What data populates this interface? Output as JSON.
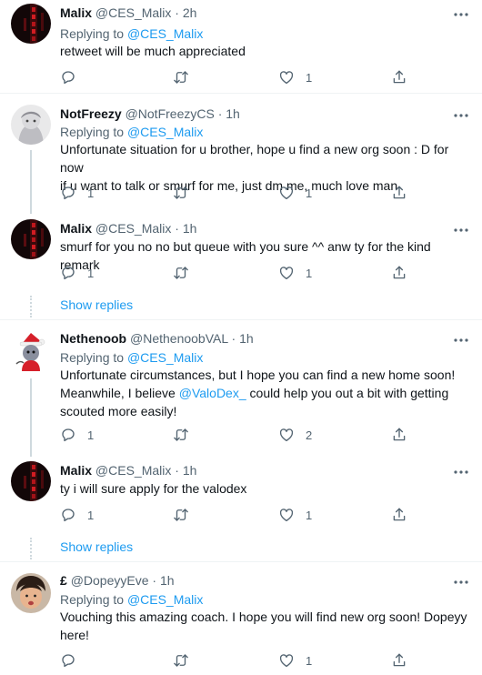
{
  "tweets": [
    {
      "name": "Malix",
      "handle": "@CES_Malix",
      "time": "2h",
      "replying_label": "Replying to",
      "replying_to": "@CES_Malix",
      "text": "retweet will be much appreciated",
      "replies": "",
      "retweets": "",
      "likes": "1"
    },
    {
      "name": "NotFreezy",
      "handle": "@NotFreezyCS",
      "time": "1h",
      "replying_label": "Replying to",
      "replying_to": "@CES_Malix",
      "text_line1": "Unfortunate situation for u brother, hope u find a new org soon : D for now",
      "text_line2": "if u want to talk or smurf for me, just dm me, much love man",
      "replies": "1",
      "retweets": "",
      "likes": "1"
    },
    {
      "name": "Malix",
      "handle": "@CES_Malix",
      "time": "1h",
      "text": "smurf for you no no but queue with you sure ^^ anw ty for the kind remark",
      "replies": "1",
      "retweets": "",
      "likes": "1"
    },
    {
      "name": "Nethenoob",
      "handle": "@NethenoobVAL",
      "time": "1h",
      "replying_label": "Replying to",
      "replying_to": "@CES_Malix",
      "text_line1": "Unfortunate circumstances, but I hope you can find a new home soon!",
      "text_line2_pre": "Meanwhile, I believe ",
      "text_line2_mention": "@ValoDex_",
      "text_line2_post": " could help you out a bit with getting",
      "text_line3": "scouted more easily!",
      "replies": "1",
      "retweets": "",
      "likes": "2"
    },
    {
      "name": "Malix",
      "handle": "@CES_Malix",
      "time": "1h",
      "text": "ty i will sure apply for the valodex",
      "replies": "1",
      "retweets": "",
      "likes": "1"
    },
    {
      "name": "£",
      "handle": "@DopeyyEve",
      "time": "1h",
      "replying_label": "Replying to",
      "replying_to": "@CES_Malix",
      "text_line1": "Vouching this amazing coach. I hope you will find new org soon! Dopeyy",
      "text_line2": "here!",
      "replies": "",
      "retweets": "",
      "likes": "1"
    }
  ],
  "show_replies_label": "Show replies",
  "separator_dot": "·",
  "colors": {
    "link": "#1d9bf0",
    "secondary_text": "#536471",
    "primary_text": "#0f1419",
    "border": "#eff3f4"
  },
  "icons": [
    "more-icon",
    "reply-icon",
    "retweet-icon",
    "like-icon",
    "share-icon"
  ]
}
